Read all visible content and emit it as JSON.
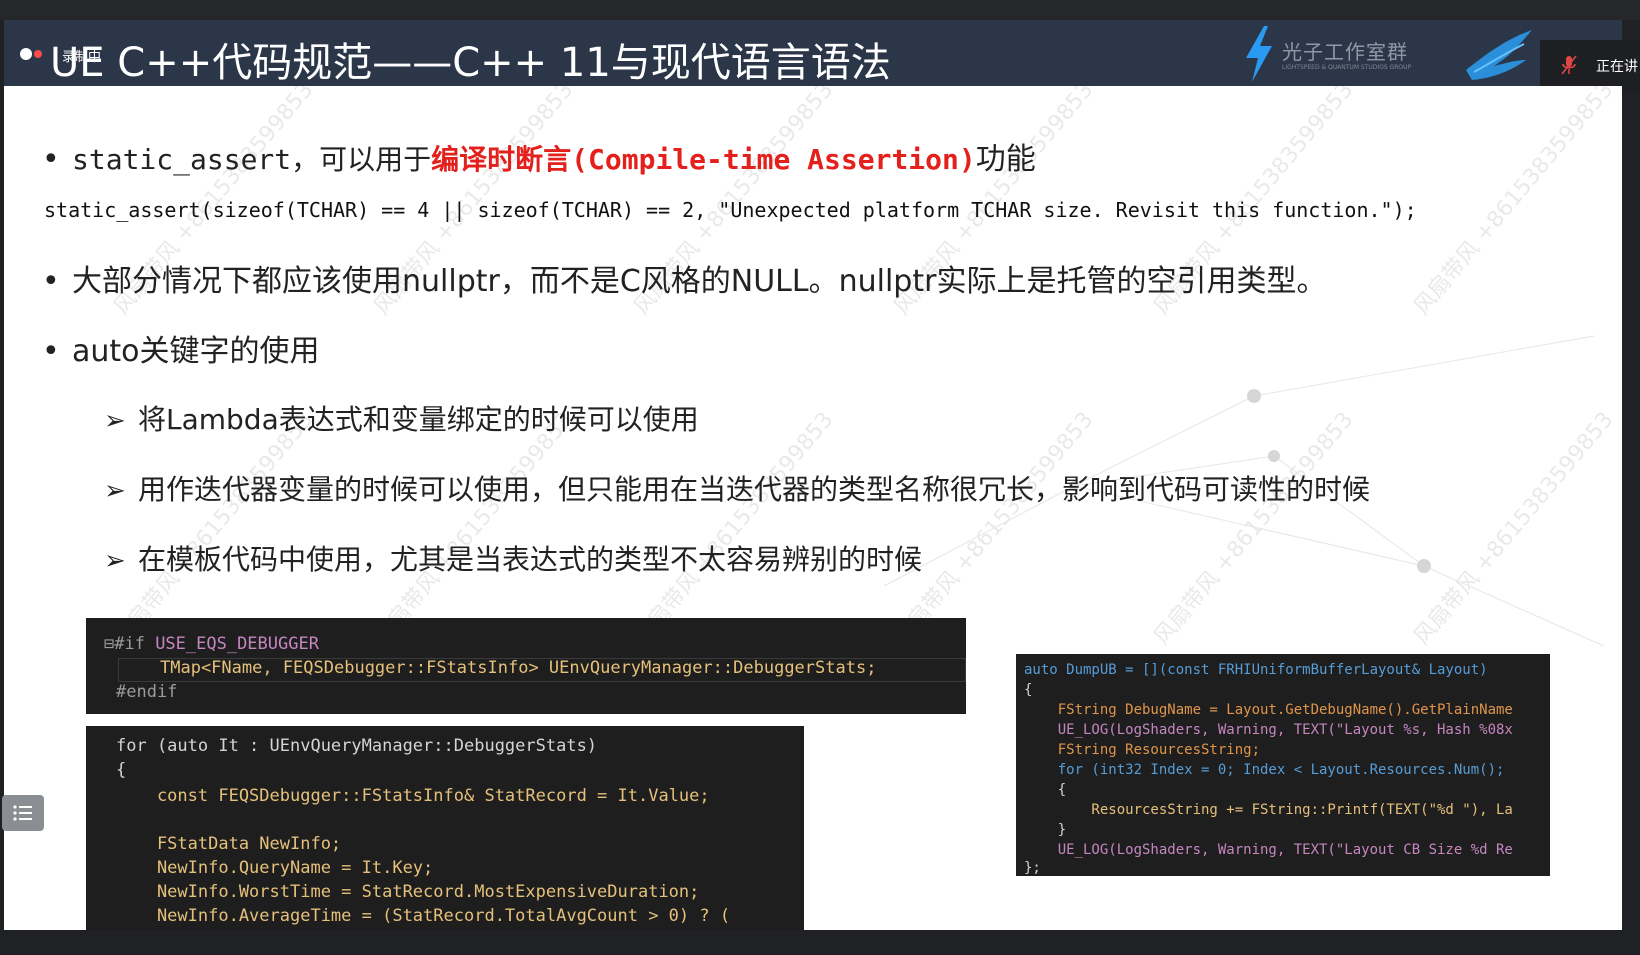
{
  "header": {
    "recording_label": "录制中",
    "slide_title": "UE C++代码规范——C++ 11与现代语言语法",
    "logo_text": "光子工作室群",
    "logo_subtext": "LIGHTSPEED & QUANTUM STUDIOS GROUP",
    "speaking_label": "正在讲"
  },
  "slide": {
    "bullet1": {
      "prefix": "static_assert，可以用于",
      "highlight": "编译时断言(Compile-time Assertion)",
      "suffix": "功能"
    },
    "code_line": "static_assert(sizeof(TCHAR) == 4 || sizeof(TCHAR) == 2, \"Unexpected platform TCHAR size. Revisit this function.\");",
    "bullet2": "大部分情况下都应该使用nullptr，而不是C风格的NULL。nullptr实际上是托管的空引用类型。",
    "bullet3": "auto关键字的使用",
    "sub_items": [
      "将Lambda表达式和变量绑定的时候可以使用",
      "用作迭代器变量的时候可以使用，但只能用在当迭代器的类型名称很冗长，影响到代码可读性的时候",
      "在模板代码中使用，尤其是当表达式的类型不太容易辨别的时候"
    ],
    "watermark_text": "风扇带风 +8615383599853"
  },
  "code1": {
    "line1_prefix": "⊟#if ",
    "line1_macro": "USE_EQS_DEBUGGER",
    "line2": "TMap<FName, FEQSDebugger::FStatsInfo> UEnvQueryManager::DebuggerStats;",
    "line3": "#endif"
  },
  "code2": {
    "lines": [
      "for (auto It : UEnvQueryManager::DebuggerStats)",
      "{",
      "    const FEQSDebugger::FStatsInfo& StatRecord = It.Value;",
      "",
      "    FStatData NewInfo;",
      "    NewInfo.QueryName = It.Key;",
      "    NewInfo.WorstTime = StatRecord.MostExpensiveDuration;",
      "    NewInfo.AverageTime = (StatRecord.TotalAvgCount > 0) ? ("
    ]
  },
  "code3": {
    "lines": [
      "auto DumpUB = [](const FRHIUniformBufferLayout& Layout)",
      "{",
      "    FString DebugName = Layout.GetDebugName().GetPlainName",
      "    UE_LOG(LogShaders, Warning, TEXT(\"Layout %s, Hash %08x",
      "    FString ResourcesString;",
      "    for (int32 Index = 0; Index < Layout.Resources.Num();",
      "    {",
      "        ResourcesString += FString::Printf(TEXT(\"%d \"), La",
      "    }",
      "    UE_LOG(LogShaders, Warning, TEXT(\"Layout CB Size %d Re",
      "};"
    ]
  },
  "colors": {
    "title_bar": "#2b3748",
    "highlight_red": "#e4201c",
    "code_bg": "#1e1e1e",
    "slide_bg": "#ffffff"
  }
}
